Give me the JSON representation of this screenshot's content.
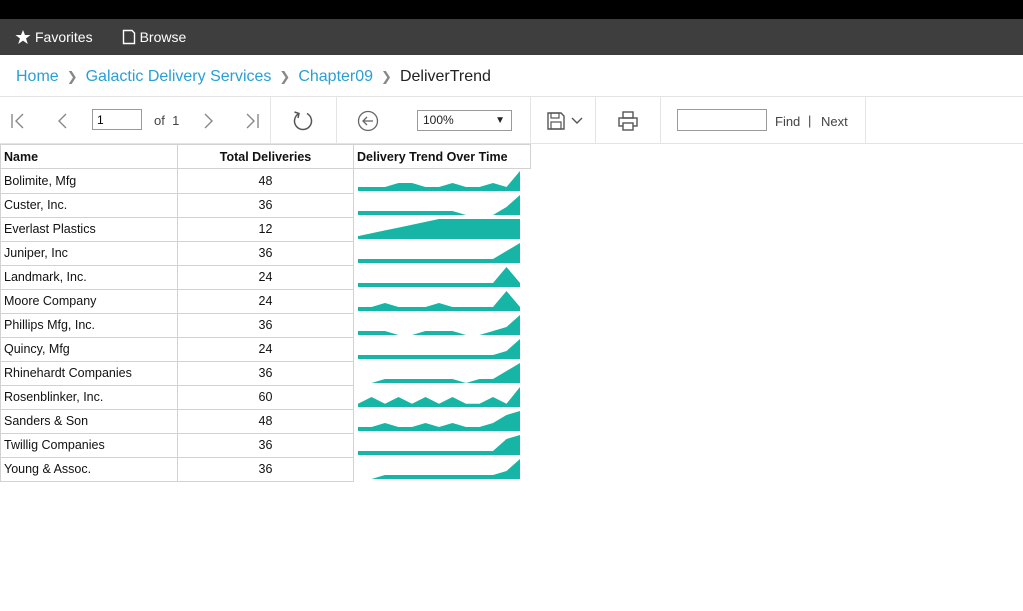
{
  "nav": {
    "favorites_label": "Favorites",
    "browse_label": "Browse"
  },
  "breadcrumb": {
    "items": [
      "Home",
      "Galactic Delivery Services",
      "Chapter09"
    ],
    "current": "DeliverTrend"
  },
  "toolbar": {
    "page_value": "1",
    "of_label": "of",
    "total_pages": "1",
    "zoom_value": "100%",
    "find_label": "Find",
    "separator": "|",
    "next_label": "Next"
  },
  "table": {
    "headers": [
      "Name",
      "Total Deliveries",
      "Delivery Trend Over Time"
    ],
    "rows": [
      {
        "name": "Bolimite, Mfg",
        "total": "48"
      },
      {
        "name": "Custer, Inc.",
        "total": "36"
      },
      {
        "name": "Everlast Plastics",
        "total": "12"
      },
      {
        "name": "Juniper, Inc",
        "total": "36"
      },
      {
        "name": "Landmark, Inc.",
        "total": "24"
      },
      {
        "name": "Moore Company",
        "total": "24"
      },
      {
        "name": "Phillips Mfg, Inc.",
        "total": "36"
      },
      {
        "name": "Quincy, Mfg",
        "total": "24"
      },
      {
        "name": "Rhinehardt Companies",
        "total": "36"
      },
      {
        "name": "Rosenblinker, Inc.",
        "total": "60"
      },
      {
        "name": "Sanders & Son",
        "total": "48"
      },
      {
        "name": "Twillig Companies",
        "total": "36"
      },
      {
        "name": "Young & Assoc.",
        "total": "36"
      }
    ]
  },
  "chart_data": {
    "type": "area",
    "color": "#17b5a5",
    "series": [
      {
        "values": [
          1,
          1,
          1,
          2,
          2,
          1,
          1,
          2,
          1,
          1,
          2,
          1,
          5
        ]
      },
      {
        "values": [
          1,
          1,
          1,
          1,
          1,
          1,
          1,
          1,
          0,
          0,
          0,
          2,
          5
        ]
      },
      {
        "values": [
          1,
          2,
          3,
          4,
          5,
          6,
          7,
          7,
          7,
          7,
          7,
          7,
          7
        ]
      },
      {
        "values": [
          1,
          1,
          1,
          1,
          1,
          1,
          1,
          1,
          1,
          1,
          1,
          3,
          5
        ]
      },
      {
        "values": [
          1,
          1,
          1,
          1,
          1,
          1,
          1,
          1,
          1,
          1,
          1,
          5,
          1
        ]
      },
      {
        "values": [
          1,
          1,
          2,
          1,
          1,
          1,
          2,
          1,
          1,
          1,
          1,
          5,
          1
        ]
      },
      {
        "values": [
          1,
          1,
          1,
          0,
          0,
          1,
          1,
          1,
          0,
          0,
          1,
          2,
          5
        ]
      },
      {
        "values": [
          1,
          1,
          1,
          1,
          1,
          1,
          1,
          1,
          1,
          1,
          1,
          2,
          5
        ]
      },
      {
        "values": [
          0,
          0,
          1,
          1,
          1,
          1,
          1,
          1,
          0,
          1,
          1,
          3,
          5
        ]
      },
      {
        "values": [
          1,
          3,
          1,
          3,
          1,
          3,
          1,
          3,
          1,
          1,
          3,
          1,
          6
        ]
      },
      {
        "values": [
          1,
          1,
          2,
          1,
          1,
          2,
          1,
          2,
          1,
          1,
          2,
          4,
          5
        ]
      },
      {
        "values": [
          1,
          1,
          1,
          1,
          1,
          1,
          1,
          1,
          1,
          1,
          1,
          4,
          5
        ]
      },
      {
        "values": [
          0,
          0,
          1,
          1,
          1,
          1,
          1,
          1,
          1,
          1,
          1,
          2,
          5
        ]
      }
    ]
  }
}
